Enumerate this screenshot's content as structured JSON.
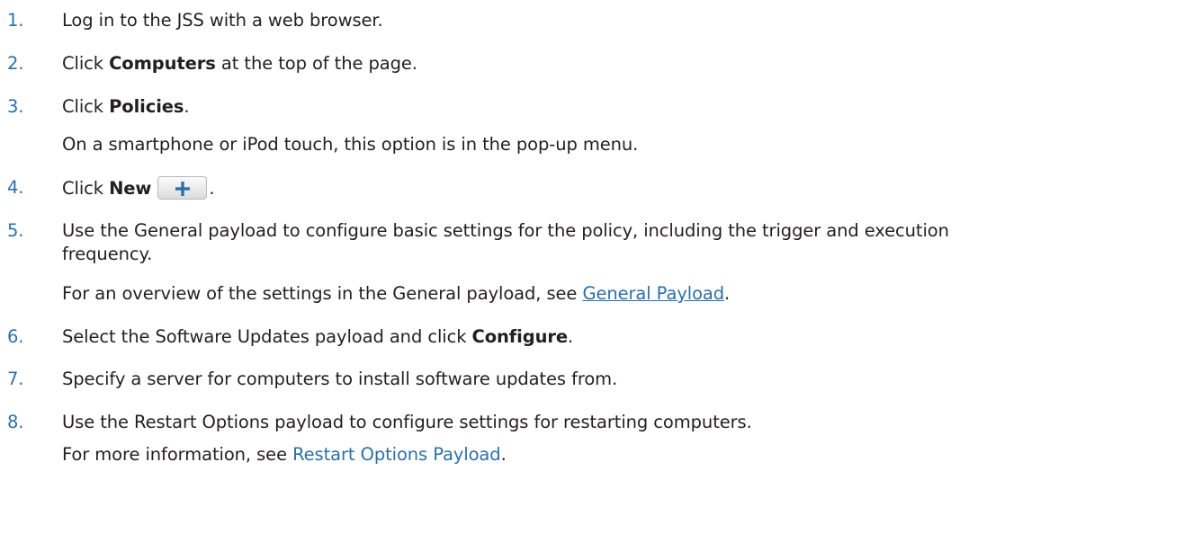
{
  "steps": [
    {
      "number": "1.",
      "parts": [
        "Log in to the JSS with a web browser."
      ]
    },
    {
      "number": "2.",
      "before": "Click ",
      "bold": "Computers",
      "after": " at the top of the page."
    },
    {
      "number": "3.",
      "before": "Click ",
      "bold": "Policies",
      "after": ".",
      "sub": "On a smartphone or iPod touch, this option is in the pop-up menu."
    },
    {
      "number": "4.",
      "before": "Click ",
      "bold": "New",
      "after": ".",
      "icon": "plus-icon"
    },
    {
      "number": "5.",
      "line1": "Use the General payload to configure basic settings for the policy, including the trigger and execution",
      "line2": "frequency.",
      "sub_before": "For an overview of the settings in the General payload, see ",
      "sub_link": "General Payload",
      "sub_after": "."
    },
    {
      "number": "6.",
      "before": "Select the Software Updates payload and click ",
      "bold": "Configure",
      "after": "."
    },
    {
      "number": "7.",
      "parts": [
        "Specify a server for computers to install software updates from."
      ]
    },
    {
      "number": "8.",
      "line1": "Use the Restart Options payload to configure settings for restarting computers.",
      "sub_before": "For more information, see ",
      "sub_link": "Restart Options Payload",
      "sub_after": "."
    }
  ],
  "colors": {
    "number": "#2e6fa8",
    "link": "#2e6fa8",
    "text": "#231f20"
  }
}
